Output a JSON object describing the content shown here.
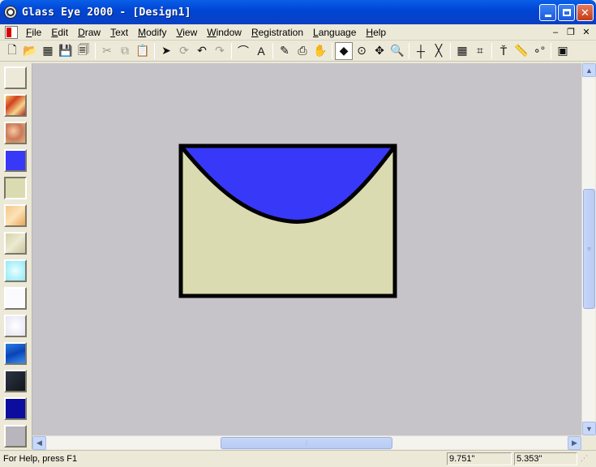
{
  "window": {
    "title": "Glass Eye 2000 - [Design1]",
    "minimize": "",
    "maximize": "",
    "close": "✕"
  },
  "menu": {
    "items": [
      {
        "u": "F",
        "rest": "ile"
      },
      {
        "u": "E",
        "rest": "dit"
      },
      {
        "u": "D",
        "rest": "raw"
      },
      {
        "u": "T",
        "rest": "ext"
      },
      {
        "u": "M",
        "rest": "odify"
      },
      {
        "u": "V",
        "rest": "iew"
      },
      {
        "u": "W",
        "rest": "indow"
      },
      {
        "u": "R",
        "rest": "egistration"
      },
      {
        "u": "L",
        "rest": "anguage"
      },
      {
        "u": "H",
        "rest": "elp"
      }
    ],
    "mdi_min": "–",
    "mdi_restore": "❐",
    "mdi_close": "✕"
  },
  "toolbar": {
    "groups": [
      [
        {
          "icon": "new-file-icon",
          "glyph": "🗋"
        },
        {
          "icon": "open-folder-icon",
          "glyph": "📂"
        },
        {
          "icon": "grid-icon",
          "glyph": "▦"
        },
        {
          "icon": "save-icon",
          "glyph": "💾"
        },
        {
          "icon": "print-preview-icon",
          "glyph": "🗐"
        }
      ],
      [
        {
          "icon": "cut-icon",
          "glyph": "✂",
          "disabled": true
        },
        {
          "icon": "copy-icon",
          "glyph": "⧉",
          "disabled": true
        },
        {
          "icon": "paste-icon",
          "glyph": "📋"
        }
      ],
      [
        {
          "icon": "select-arrow-icon",
          "glyph": "➤"
        },
        {
          "icon": "rotate-icon",
          "glyph": "⟳",
          "disabled": true
        },
        {
          "icon": "undo-icon",
          "glyph": "↶"
        },
        {
          "icon": "redo-icon",
          "glyph": "↷",
          "disabled": true
        }
      ],
      [
        {
          "icon": "curve-tool-icon",
          "glyph": "⌒"
        },
        {
          "icon": "text-tool-icon",
          "glyph": "A"
        }
      ],
      [
        {
          "icon": "pencil-icon",
          "glyph": "✎"
        },
        {
          "icon": "stamp-icon",
          "glyph": "⎙"
        },
        {
          "icon": "hand-icon",
          "glyph": "✋"
        }
      ],
      [
        {
          "icon": "fill-bucket-icon",
          "glyph": "◆",
          "pressed": true
        },
        {
          "icon": "target-icon",
          "glyph": "⊙"
        },
        {
          "icon": "move-icon",
          "glyph": "✥"
        },
        {
          "icon": "zoom-icon",
          "glyph": "🔍"
        }
      ],
      [
        {
          "icon": "line-icon",
          "glyph": "┼"
        },
        {
          "icon": "cross-icon",
          "glyph": "╳"
        }
      ],
      [
        {
          "icon": "grid-show-icon",
          "glyph": "▦"
        },
        {
          "icon": "snap-icon",
          "glyph": "⌗"
        }
      ],
      [
        {
          "icon": "text-cursor-icon",
          "glyph": "Ť"
        },
        {
          "icon": "ruler-icon",
          "glyph": "📏"
        },
        {
          "icon": "nodes-icon",
          "glyph": "∘°"
        }
      ],
      [
        {
          "icon": "pattern-icon",
          "glyph": "▣"
        }
      ]
    ]
  },
  "palette": {
    "swatches": [
      {
        "name": "empty",
        "fill": "#ece9d8"
      },
      {
        "name": "streaky-red",
        "fill": "linear-gradient(135deg,#f5c06a,#d0421e,#f7d48b,#b3261a)"
      },
      {
        "name": "amber-mottled",
        "fill": "radial-gradient(circle at 40% 40%,#f8c9a0,#c97a5a,#e9b27c)"
      },
      {
        "name": "blue",
        "fill": "#3838f8"
      },
      {
        "name": "cream",
        "fill": "#dbdbb1",
        "selected": true
      },
      {
        "name": "peach-texture",
        "fill": "linear-gradient(135deg,#f7c58a,#fbe3b7,#e9a457)"
      },
      {
        "name": "beige-texture",
        "fill": "linear-gradient(135deg,#d5d2ad,#ecead0,#c9c59f)"
      },
      {
        "name": "light-cyan",
        "fill": "radial-gradient(circle,#eaffff,#8ee8f7)"
      },
      {
        "name": "white",
        "fill": "#fbfbff"
      },
      {
        "name": "opal-white",
        "fill": "radial-gradient(circle,#fff,#e6e3f0)"
      },
      {
        "name": "blue-ripple",
        "fill": "linear-gradient(160deg,#2d7fe0,#0a43b8,#3b8ff0)"
      },
      {
        "name": "dark-slate",
        "fill": "linear-gradient(135deg,#2c3542,#11161e)"
      },
      {
        "name": "navy",
        "fill": "#0c0c9e"
      },
      {
        "name": "gray",
        "fill": "#b8b6bc"
      }
    ]
  },
  "design": {
    "body_fill": "#dbdbb1",
    "flap_fill": "#3838f8",
    "outline": "#000000"
  },
  "status": {
    "help": "For Help, press F1",
    "x": "9.751\"",
    "y": "5.353\""
  }
}
